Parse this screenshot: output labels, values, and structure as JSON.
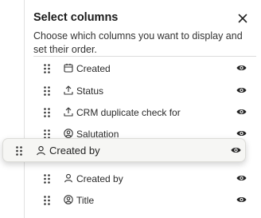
{
  "panel": {
    "title": "Select columns",
    "description": "Choose which columns you want to display and set their order.",
    "close_icon": "close-icon"
  },
  "columns": [
    {
      "label": "Created",
      "icon": "calendar-icon",
      "visible": true
    },
    {
      "label": "Status",
      "icon": "upload-icon",
      "visible": true
    },
    {
      "label": "CRM duplicate check for",
      "icon": "upload-icon",
      "visible": true
    },
    {
      "label": "Salutation",
      "icon": "user-circle-icon",
      "visible": true
    },
    {
      "label": "Created by",
      "icon": "user-icon",
      "visible": true
    },
    {
      "label": "Title",
      "icon": "user-circle-icon",
      "visible": true
    }
  ],
  "dragging": {
    "label": "Created by",
    "icon": "user-icon",
    "visible": true
  },
  "colors": {
    "accent_border": "#dcdcd8",
    "drag_bg": "#f6f6f4",
    "icon": "#333333"
  }
}
